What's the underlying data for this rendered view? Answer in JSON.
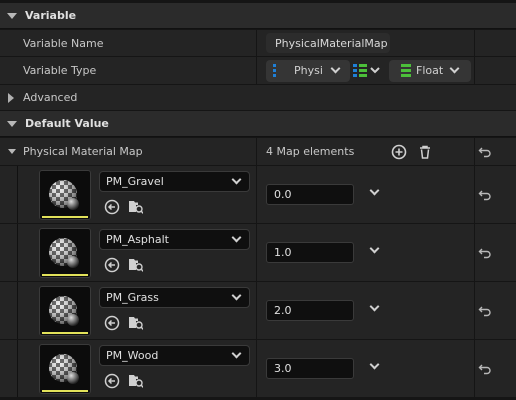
{
  "sections": {
    "variable": "Variable",
    "default_value": "Default Value"
  },
  "variable_name": {
    "label": "Variable Name",
    "value": "PhysicalMaterialMap"
  },
  "variable_type": {
    "label": "Variable Type",
    "key_type": "Physi",
    "value_type": "Float"
  },
  "advanced": {
    "label": "Advanced"
  },
  "map": {
    "label": "Physical Material Map",
    "count_text": "4 Map elements",
    "elements": [
      {
        "key": "PM_Gravel",
        "value": "0.0"
      },
      {
        "key": "PM_Asphalt",
        "value": "1.0"
      },
      {
        "key": "PM_Grass",
        "value": "2.0"
      },
      {
        "key": "PM_Wood",
        "value": "3.0"
      }
    ]
  },
  "colors": {
    "key_type_accent": "#1f7fd6",
    "value_type_accent": "#4cbf3a",
    "thumb_underline": "#e2e25a"
  },
  "icons": {
    "collapse": "triangle-down-icon",
    "expand": "triangle-right-icon",
    "add": "plus-circle-icon",
    "delete": "trash-icon",
    "reset": "reset-arrow-icon",
    "use_selected": "arrow-left-circle-icon",
    "browse": "folder-search-icon",
    "container": "map-container-icon"
  }
}
